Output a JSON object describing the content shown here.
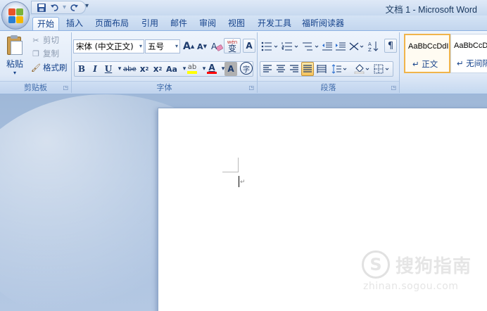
{
  "window": {
    "title": "文档 1 - Microsoft Word"
  },
  "quick_access": {
    "more": "▾"
  },
  "tabs": [
    {
      "label": "开始",
      "active": true
    },
    {
      "label": "插入"
    },
    {
      "label": "页面布局"
    },
    {
      "label": "引用"
    },
    {
      "label": "邮件"
    },
    {
      "label": "审阅"
    },
    {
      "label": "视图"
    },
    {
      "label": "开发工具"
    },
    {
      "label": "福昕阅读器"
    }
  ],
  "clipboard": {
    "label": "剪贴板",
    "paste": "粘贴",
    "paste_arrow": "▾",
    "cut": "剪切",
    "copy": "复制",
    "format_painter": "格式刷"
  },
  "font": {
    "label": "字体",
    "name": "宋体 (中文正文)",
    "size": "五号",
    "grow": "A",
    "shrink": "A",
    "clear": "A",
    "phonetic": "wén",
    "phonetic_char": "变",
    "border_char": "A",
    "bold": "B",
    "italic": "I",
    "underline": "U",
    "strike": "abe",
    "subscript": "x",
    "superscript": "x",
    "case": "Aa",
    "highlight": "ab",
    "font_color": "A",
    "shading_char": "A",
    "enclose_char": "字"
  },
  "paragraph": {
    "label": "段落"
  },
  "styles": {
    "items": [
      {
        "sample": "AaBbCcDdI",
        "name": "↵ 正文",
        "selected": true
      },
      {
        "sample": "AaBbCcD",
        "name": "↵ 无间隔"
      }
    ]
  },
  "watermark": {
    "logo": "S",
    "text": "搜狗指南",
    "url": "zhinan.sogou.com"
  },
  "colors": {
    "accent": "#15428b",
    "highlight": "#ffff00",
    "font_red": "#ff0000",
    "selected_style": "#f0b44b"
  }
}
